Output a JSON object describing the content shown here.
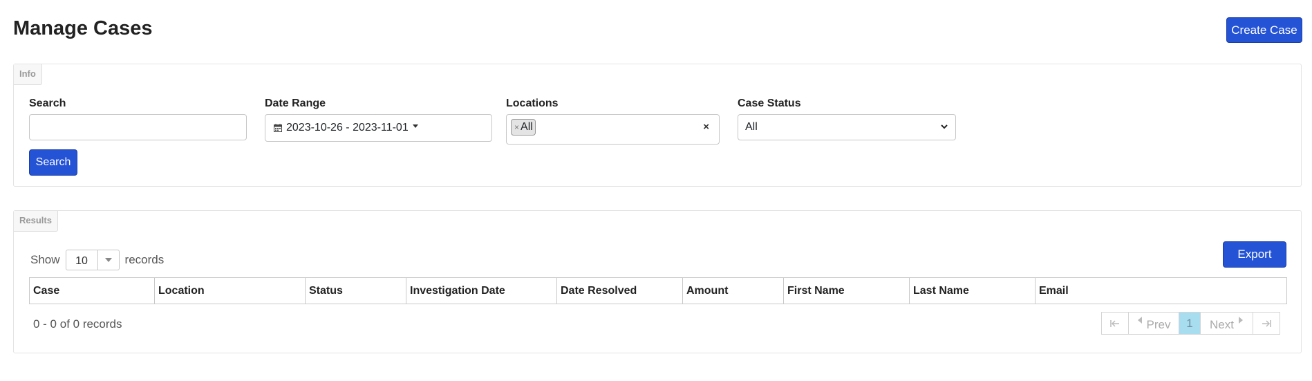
{
  "page": {
    "title": "Manage Cases",
    "create_button": "Create Case"
  },
  "info": {
    "legend": "Info",
    "search_label": "Search",
    "search_value": "",
    "date_label": "Date Range",
    "date_value": "2023-10-26 - 2023-11-01",
    "locations_label": "Locations",
    "locations_tag": "All",
    "status_label": "Case Status",
    "status_value": "All",
    "search_button": "Search"
  },
  "results": {
    "legend": "Results",
    "show_label": "Show",
    "page_size": "10",
    "records_label": "records",
    "export_button": "Export",
    "columns": [
      "Case",
      "Location",
      "Status",
      "Investigation Date",
      "Date Resolved",
      "Amount",
      "First Name",
      "Last Name",
      "Email"
    ],
    "summary": "0 - 0 of 0 records",
    "pager": {
      "prev": "Prev",
      "current": "1",
      "next": "Next"
    }
  },
  "colors": {
    "primary": "#2453d6",
    "active_page": "#a8dcef"
  }
}
